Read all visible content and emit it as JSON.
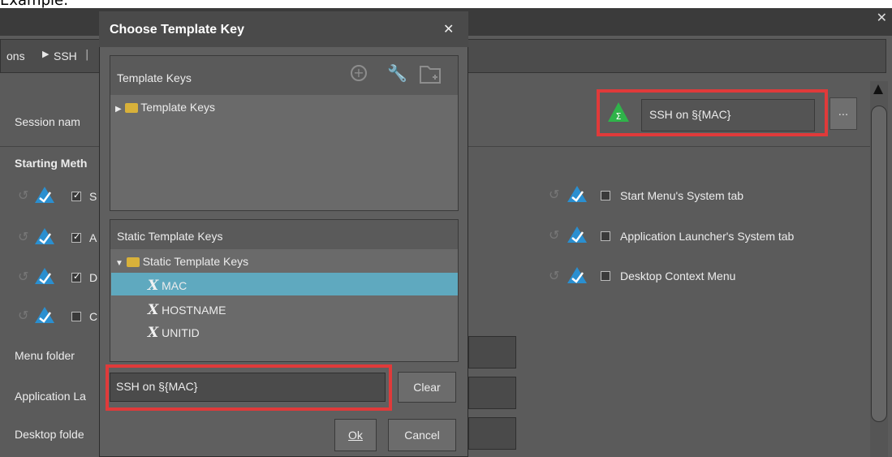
{
  "caption": "Example:",
  "bg": {
    "breadcrumb": [
      "ons",
      "SSH"
    ],
    "session_label": "Session nam",
    "session_value": "SSH on §{MAC}",
    "dots_label": "...",
    "section_title": "Starting Meth",
    "left_rows": [
      {
        "letter": "S",
        "checked": true
      },
      {
        "letter": "A",
        "checked": true
      },
      {
        "letter": "D",
        "checked": true
      },
      {
        "letter": "C",
        "checked": false
      }
    ],
    "right_rows": [
      {
        "label": "Start Menu's System tab",
        "checked": false
      },
      {
        "label": "Application Launcher's System tab",
        "checked": false
      },
      {
        "label": "Desktop Context Menu",
        "checked": false
      }
    ],
    "menu_folder": "Menu folder",
    "app_launcher": "Application La",
    "desktop_folder": "Desktop folde"
  },
  "dialog": {
    "title": "Choose Template Key",
    "close": "✕",
    "template_keys_title": "Template Keys",
    "template_keys_root": "Template Keys",
    "static_title": "Static Template Keys",
    "static_root": "Static Template Keys",
    "static_items": [
      "MAC",
      "HOSTNAME",
      "UNITID"
    ],
    "selected_index": 0,
    "input_value": "SSH on §{MAC}",
    "clear_label": "Clear",
    "ok_label": "Ok",
    "cancel_label": "Cancel"
  },
  "colors": {
    "highlight": "#e03a3a",
    "selection": "#5fa9bf",
    "accent_green": "#2fb34a"
  }
}
